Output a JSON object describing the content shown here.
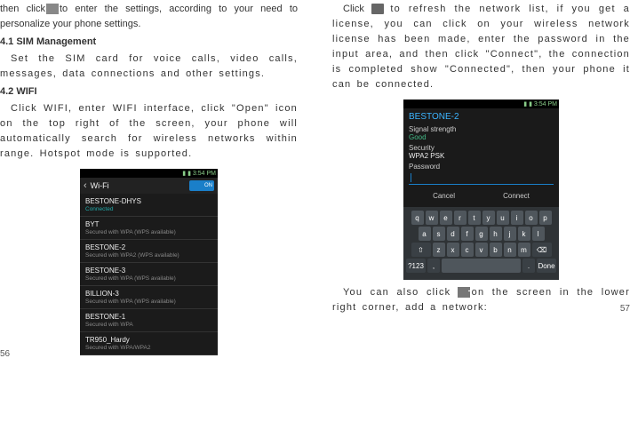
{
  "left": {
    "para1_a": "then click",
    "para1_b": "to enter the settings, according to your need to personalize your phone settings.",
    "h1": "4.1 SIM Management",
    "para2": "Set the SIM card for voice calls, video calls, messages, data connections and other settings.",
    "h2": "4.2 WIFI",
    "para3": "Click WIFI, enter WIFI interface, click \"Open\" icon on the top right of the screen, your phone will automatically search for wireless networks within range. Hotspot mode is supported.",
    "page_num": "56"
  },
  "right": {
    "para1_a": "Click",
    "para1_b": "to refresh the network list, if you get a license, you can click on your wireless network license has been made, enter the password in the input area, and then click \"Connect\", the connection is completed show \"Connected\", then your phone it can be connected.",
    "para2_a": "You can also click",
    "para2_b": "on the screen in the lower right corner, add a network:",
    "page_num": "57",
    "plus_glyph": "+"
  },
  "wifi_list": {
    "status_time": "3:54 PM",
    "header": "Wi-Fi",
    "toggle": "ON",
    "items": [
      {
        "title": "BESTONE-DHYS",
        "sub": "Connected",
        "connected": true
      },
      {
        "title": "BYT",
        "sub": "Secured with WPA (WPS available)"
      },
      {
        "title": "BESTONE-2",
        "sub": "Secured with WPA2 (WPS available)"
      },
      {
        "title": "BESTONE-3",
        "sub": "Secured with WPA (WPS available)"
      },
      {
        "title": "BILLION-3",
        "sub": "Secured with WPA (WPS available)"
      },
      {
        "title": "BESTONE-1",
        "sub": "Secured with WPA"
      },
      {
        "title": "TR950_Hardy",
        "sub": "Secured with WPA/WPA2"
      }
    ]
  },
  "wifi_dialog": {
    "status_time": "3:54 PM",
    "network": "BESTONE-2",
    "signal_label": "Signal strength",
    "signal_value": "Good",
    "security_label": "Security",
    "security_value": "WPA2 PSK",
    "password_label": "Password",
    "btn_cancel": "Cancel",
    "btn_connect": "Connect",
    "kb_row1": [
      "q",
      "w",
      "e",
      "r",
      "t",
      "y",
      "u",
      "i",
      "o",
      "p"
    ],
    "kb_row2": [
      "a",
      "s",
      "d",
      "f",
      "g",
      "h",
      "j",
      "k",
      "l"
    ],
    "kb_row3": [
      "z",
      "x",
      "c",
      "v",
      "b",
      "n",
      "m"
    ],
    "kb_row4_sym": "?123",
    "kb_row4_done": "Done"
  }
}
